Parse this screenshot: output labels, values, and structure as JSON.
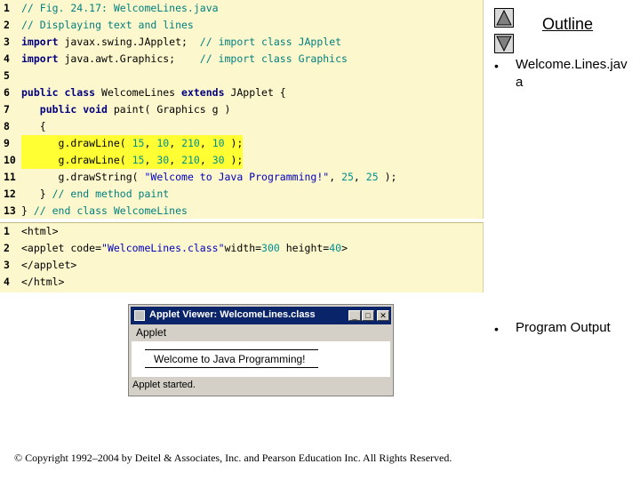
{
  "java_listing": {
    "lines": [
      {
        "num": "1",
        "parts": [
          {
            "t": "// Fig. 24.17: WelcomeLines.java",
            "c": "cm"
          }
        ]
      },
      {
        "num": "2",
        "parts": [
          {
            "t": "// Displaying text and lines",
            "c": "cm"
          }
        ]
      },
      {
        "num": "3",
        "parts": [
          {
            "t": "import ",
            "c": "kw"
          },
          {
            "t": "javax.swing.JApplet;",
            "c": "plain"
          },
          {
            "t": "  // import class JApplet",
            "c": "cm"
          }
        ]
      },
      {
        "num": "4",
        "parts": [
          {
            "t": "import ",
            "c": "kw"
          },
          {
            "t": "java.awt.Graphics;",
            "c": "plain"
          },
          {
            "t": "    // import class Graphics",
            "c": "cm"
          }
        ]
      },
      {
        "num": "5",
        "parts": []
      },
      {
        "num": "6",
        "parts": [
          {
            "t": "public class ",
            "c": "kw"
          },
          {
            "t": "WelcomeLines ",
            "c": "plain"
          },
          {
            "t": "extends ",
            "c": "kw"
          },
          {
            "t": "JApplet {",
            "c": "plain"
          }
        ]
      },
      {
        "num": "7",
        "parts": [
          {
            "t": "   public void ",
            "c": "kw"
          },
          {
            "t": "paint( Graphics g )",
            "c": "plain"
          }
        ]
      },
      {
        "num": "8",
        "parts": [
          {
            "t": "   {",
            "c": "plain"
          }
        ]
      },
      {
        "num": "9",
        "hl": true,
        "parts": [
          {
            "t": "      g.drawLine( ",
            "c": "plain"
          },
          {
            "t": "15",
            "c": "num"
          },
          {
            "t": ", ",
            "c": "plain"
          },
          {
            "t": "10",
            "c": "num"
          },
          {
            "t": ", ",
            "c": "plain"
          },
          {
            "t": "210",
            "c": "num"
          },
          {
            "t": ", ",
            "c": "plain"
          },
          {
            "t": "10",
            "c": "num"
          },
          {
            "t": " );",
            "c": "plain"
          }
        ]
      },
      {
        "num": "10",
        "hl": true,
        "parts": [
          {
            "t": "      g.drawLine( ",
            "c": "plain"
          },
          {
            "t": "15",
            "c": "num"
          },
          {
            "t": ", ",
            "c": "plain"
          },
          {
            "t": "30",
            "c": "num"
          },
          {
            "t": ", ",
            "c": "plain"
          },
          {
            "t": "210",
            "c": "num"
          },
          {
            "t": ", ",
            "c": "plain"
          },
          {
            "t": "30",
            "c": "num"
          },
          {
            "t": " );",
            "c": "plain"
          }
        ]
      },
      {
        "num": "11",
        "parts": [
          {
            "t": "      g.drawString( ",
            "c": "plain"
          },
          {
            "t": "\"Welcome to Java Programming!\"",
            "c": "str"
          },
          {
            "t": ", ",
            "c": "plain"
          },
          {
            "t": "25",
            "c": "num"
          },
          {
            "t": ", ",
            "c": "plain"
          },
          {
            "t": "25",
            "c": "num"
          },
          {
            "t": " );",
            "c": "plain"
          }
        ]
      },
      {
        "num": "12",
        "parts": [
          {
            "t": "   } ",
            "c": "plain"
          },
          {
            "t": "// end method paint",
            "c": "cm"
          }
        ]
      },
      {
        "num": "13",
        "parts": [
          {
            "t": "} ",
            "c": "plain"
          },
          {
            "t": "// end class WelcomeLines",
            "c": "cm"
          }
        ]
      }
    ]
  },
  "html_listing": {
    "lines": [
      {
        "num": "1",
        "parts": [
          {
            "t": "<html>",
            "c": "plain"
          }
        ]
      },
      {
        "num": "2",
        "parts": [
          {
            "t": "<applet code=",
            "c": "plain"
          },
          {
            "t": "\"WelcomeLines.class\"",
            "c": "str"
          },
          {
            "t": "width=",
            "c": "plain"
          },
          {
            "t": "300",
            "c": "num"
          },
          {
            "t": " height=",
            "c": "plain"
          },
          {
            "t": "40",
            "c": "num"
          },
          {
            "t": ">",
            "c": "plain"
          }
        ]
      },
      {
        "num": "3",
        "parts": [
          {
            "t": "</applet>",
            "c": "plain"
          }
        ]
      },
      {
        "num": "4",
        "parts": [
          {
            "t": "</html>",
            "c": "plain"
          }
        ]
      }
    ]
  },
  "outline": {
    "title": "Outline",
    "bullet_char": "•",
    "items": [
      {
        "label_line1": "Welcome.Lines.jav",
        "label_line2": "a"
      },
      {
        "label_line1": "Program Output",
        "label_line2": ""
      }
    ],
    "up_icon": "triangle-up-icon",
    "down_icon": "triangle-down-icon"
  },
  "applet_viewer": {
    "title": "Applet Viewer: WelcomeLines.class",
    "menu": "Applet",
    "drawn_string": "Welcome to Java Programming!",
    "status": "Applet started.",
    "minimize_glyph": "_",
    "maximize_glyph": "□",
    "close_glyph": "✕",
    "titlebar_color": "#0a246a"
  },
  "footer": {
    "copyright": "© Copyright 1992–2004 by Deitel & Associates, Inc. and Pearson Education Inc. All Rights Reserved."
  },
  "colors": {
    "code_background": "#fcf7cc",
    "highlight": "#ffff33",
    "keyword": "#000080",
    "comment": "#008080",
    "string": "#0000c0"
  }
}
